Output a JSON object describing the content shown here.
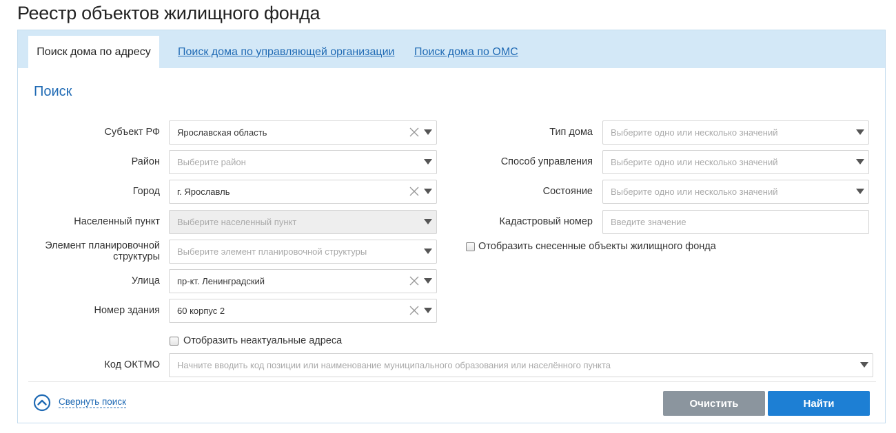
{
  "page": {
    "title": "Реестр объектов жилищного фонда"
  },
  "tabs": [
    {
      "label": "Поиск дома по адресу",
      "active": true
    },
    {
      "label": "Поиск дома по управляющей организации",
      "active": false
    },
    {
      "label": "Поиск дома по ОМС",
      "active": false
    }
  ],
  "search": {
    "title": "Поиск",
    "left": {
      "subject": {
        "label": "Субъект РФ",
        "value": "Ярославская область"
      },
      "district": {
        "label": "Район",
        "placeholder": "Выберите район"
      },
      "city": {
        "label": "Город",
        "value": "г. Ярославль"
      },
      "settlement": {
        "label": "Населенный пункт",
        "placeholder": "Выберите населенный пункт"
      },
      "planning": {
        "label_line1": "Элемент планировочной",
        "label_line2": "структуры",
        "placeholder": "Выберите элемент планировочной структуры"
      },
      "street": {
        "label": "Улица",
        "value": "пр-кт. Ленинградский"
      },
      "building": {
        "label": "Номер здания",
        "value": "60 корпус 2"
      }
    },
    "right": {
      "house_type": {
        "label": "Тип дома",
        "placeholder": "Выберите одно или несколько значений"
      },
      "management": {
        "label": "Способ управления",
        "placeholder": "Выберите одно или несколько значений"
      },
      "state": {
        "label": "Состояние",
        "placeholder": "Выберите одно или несколько значений"
      },
      "cadastral": {
        "label": "Кадастровый номер",
        "placeholder": "Введите значение"
      },
      "show_demolished": {
        "label": "Отобразить снесенные объекты жилищного фонда",
        "checked": false
      }
    },
    "show_irrelevant": {
      "label": "Отобразить неактуальные адреса",
      "checked": false
    },
    "oktmo": {
      "label": "Код ОКТМО",
      "placeholder": "Начните вводить код позиции или наименование муниципального образования или населённого пункта"
    }
  },
  "footer": {
    "collapse_label": "Свернуть поиск",
    "clear_label": "Очистить",
    "find_label": "Найти"
  },
  "colors": {
    "accent": "#1f6ab4",
    "tabbar": "#d3e8f7",
    "primary_button": "#1d7fd4",
    "secondary_button": "#8b959e"
  }
}
